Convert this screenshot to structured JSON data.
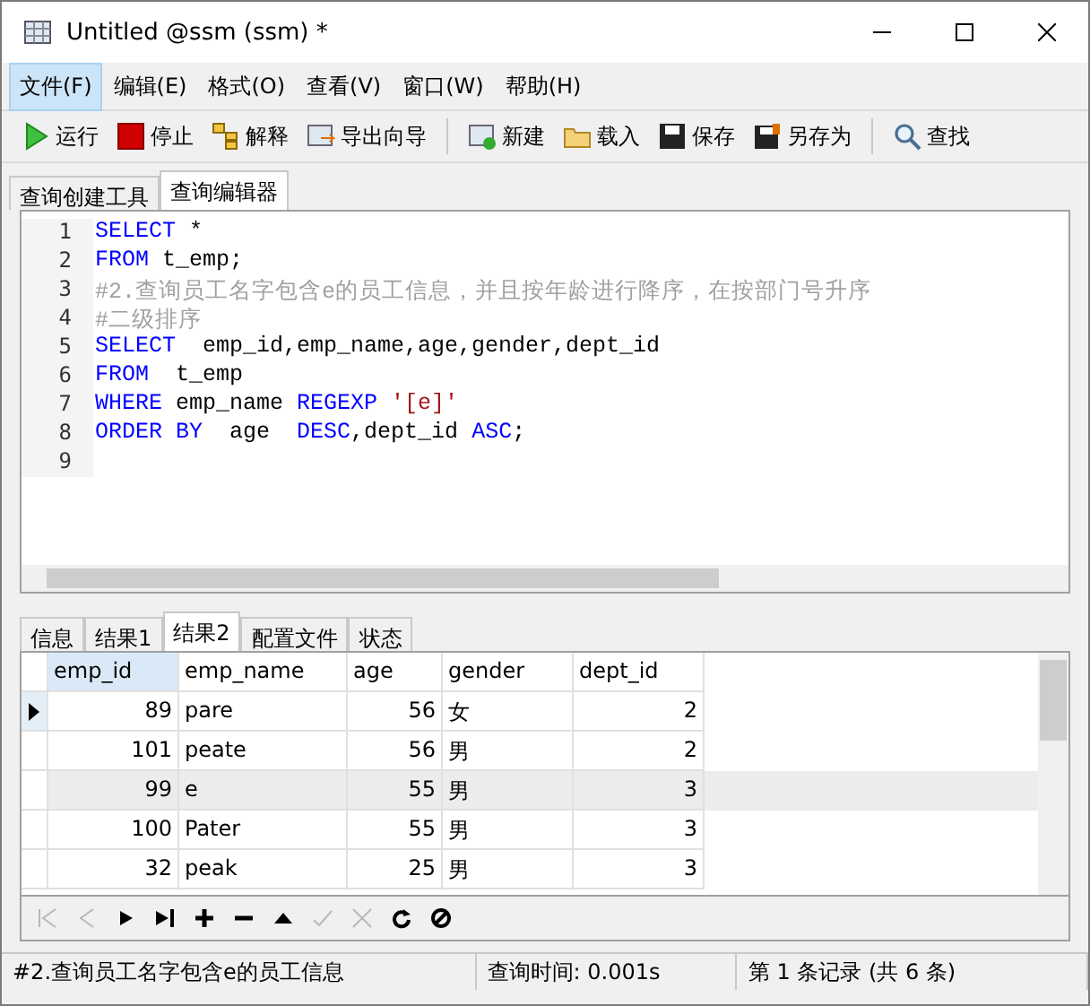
{
  "window": {
    "title": "Untitled @ssm (ssm) *"
  },
  "menu": [
    {
      "label": "文件(F)",
      "selected": true
    },
    {
      "label": "编辑(E)",
      "selected": false
    },
    {
      "label": "格式(O)",
      "selected": false
    },
    {
      "label": "查看(V)",
      "selected": false
    },
    {
      "label": "窗口(W)",
      "selected": false
    },
    {
      "label": "帮助(H)",
      "selected": false
    }
  ],
  "toolbar": [
    {
      "label": "运行",
      "kind": "run"
    },
    {
      "label": "停止",
      "kind": "stop"
    },
    {
      "label": "解释",
      "kind": "explain"
    },
    {
      "label": "导出向导",
      "kind": "export"
    },
    {
      "label": "新建",
      "kind": "new"
    },
    {
      "label": "载入",
      "kind": "load"
    },
    {
      "label": "保存",
      "kind": "save"
    },
    {
      "label": "另存为",
      "kind": "saveas"
    },
    {
      "label": "查找",
      "kind": "find"
    }
  ],
  "editor_tabs": [
    {
      "label": "查询创建工具",
      "selected": false
    },
    {
      "label": "查询编辑器",
      "selected": true
    }
  ],
  "code_lines": [
    {
      "number": "1",
      "tokens": [
        {
          "kind": "keyword",
          "text": "SELECT"
        },
        {
          "kind": "plain",
          "text": " *"
        }
      ]
    },
    {
      "number": "2",
      "tokens": [
        {
          "kind": "keyword",
          "text": "FROM"
        },
        {
          "kind": "plain",
          "text": " t_emp;"
        }
      ]
    },
    {
      "number": "3",
      "tokens": [
        {
          "kind": "comment",
          "text": "#2.查询员工名字包含e的员工信息，并且按年龄进行降序，在按部门号升序"
        }
      ]
    },
    {
      "number": "4",
      "tokens": [
        {
          "kind": "comment",
          "text": "#二级排序"
        }
      ]
    },
    {
      "number": "5",
      "tokens": [
        {
          "kind": "keyword",
          "text": "SELECT"
        },
        {
          "kind": "plain",
          "text": "  emp_id,emp_name,age,gender,dept_id"
        }
      ]
    },
    {
      "number": "6",
      "tokens": [
        {
          "kind": "keyword",
          "text": "FROM"
        },
        {
          "kind": "plain",
          "text": "  t_emp"
        }
      ]
    },
    {
      "number": "7",
      "tokens": [
        {
          "kind": "keyword",
          "text": "WHERE"
        },
        {
          "kind": "plain",
          "text": " emp_name "
        },
        {
          "kind": "keyword",
          "text": "REGEXP"
        },
        {
          "kind": "string",
          "text": " '[e]'"
        }
      ]
    },
    {
      "number": "8",
      "tokens": [
        {
          "kind": "keyword",
          "text": "ORDER BY"
        },
        {
          "kind": "plain",
          "text": "  age  "
        },
        {
          "kind": "keyword",
          "text": "DESC"
        },
        {
          "kind": "plain",
          "text": ",dept_id "
        },
        {
          "kind": "keyword",
          "text": "ASC"
        },
        {
          "kind": "plain",
          "text": ";"
        }
      ]
    },
    {
      "number": "9"
    }
  ],
  "result_tabs": [
    {
      "label": "信息",
      "selected": false
    },
    {
      "label": "结果1",
      "selected": false
    },
    {
      "label": "结果2",
      "selected": true
    },
    {
      "label": "配置文件",
      "selected": false
    },
    {
      "label": "状态",
      "selected": false
    }
  ],
  "grid": {
    "columns": [
      {
        "label": "emp_id",
        "selected": true
      },
      {
        "label": "emp_name",
        "selected": false
      },
      {
        "label": "age",
        "selected": false
      },
      {
        "label": "gender",
        "selected": false
      },
      {
        "label": "dept_id",
        "selected": false
      }
    ],
    "rows": [
      {
        "current": true,
        "highlighted": false,
        "cells": [
          "89",
          "pare",
          "56",
          "女",
          "2"
        ]
      },
      {
        "current": false,
        "highlighted": false,
        "cells": [
          "101",
          "peate",
          "56",
          "男",
          "2"
        ]
      },
      {
        "current": false,
        "highlighted": true,
        "cells": [
          "99",
          "e",
          "55",
          "男",
          "3"
        ]
      },
      {
        "current": false,
        "highlighted": false,
        "cells": [
          "100",
          "Pater",
          "55",
          "男",
          "3"
        ]
      },
      {
        "current": false,
        "highlighted": false,
        "cells": [
          "32",
          "peak",
          "25",
          "男",
          "3"
        ]
      }
    ]
  },
  "navigator": [
    {
      "kind": "first",
      "disabled": true
    },
    {
      "kind": "prev",
      "disabled": true
    },
    {
      "kind": "next",
      "disabled": false
    },
    {
      "kind": "last",
      "disabled": false
    },
    {
      "kind": "add",
      "disabled": false
    },
    {
      "kind": "delete",
      "disabled": false
    },
    {
      "kind": "up",
      "disabled": false
    },
    {
      "kind": "apply",
      "disabled": true
    },
    {
      "kind": "cancel",
      "disabled": true
    },
    {
      "kind": "refresh",
      "disabled": false
    },
    {
      "kind": "clear",
      "disabled": false
    }
  ],
  "status_bar": [
    "#2.查询员工名字包含e的员工信息",
    "查询时间: 0.001s",
    "第 1 条记录 (共 6 条)"
  ]
}
